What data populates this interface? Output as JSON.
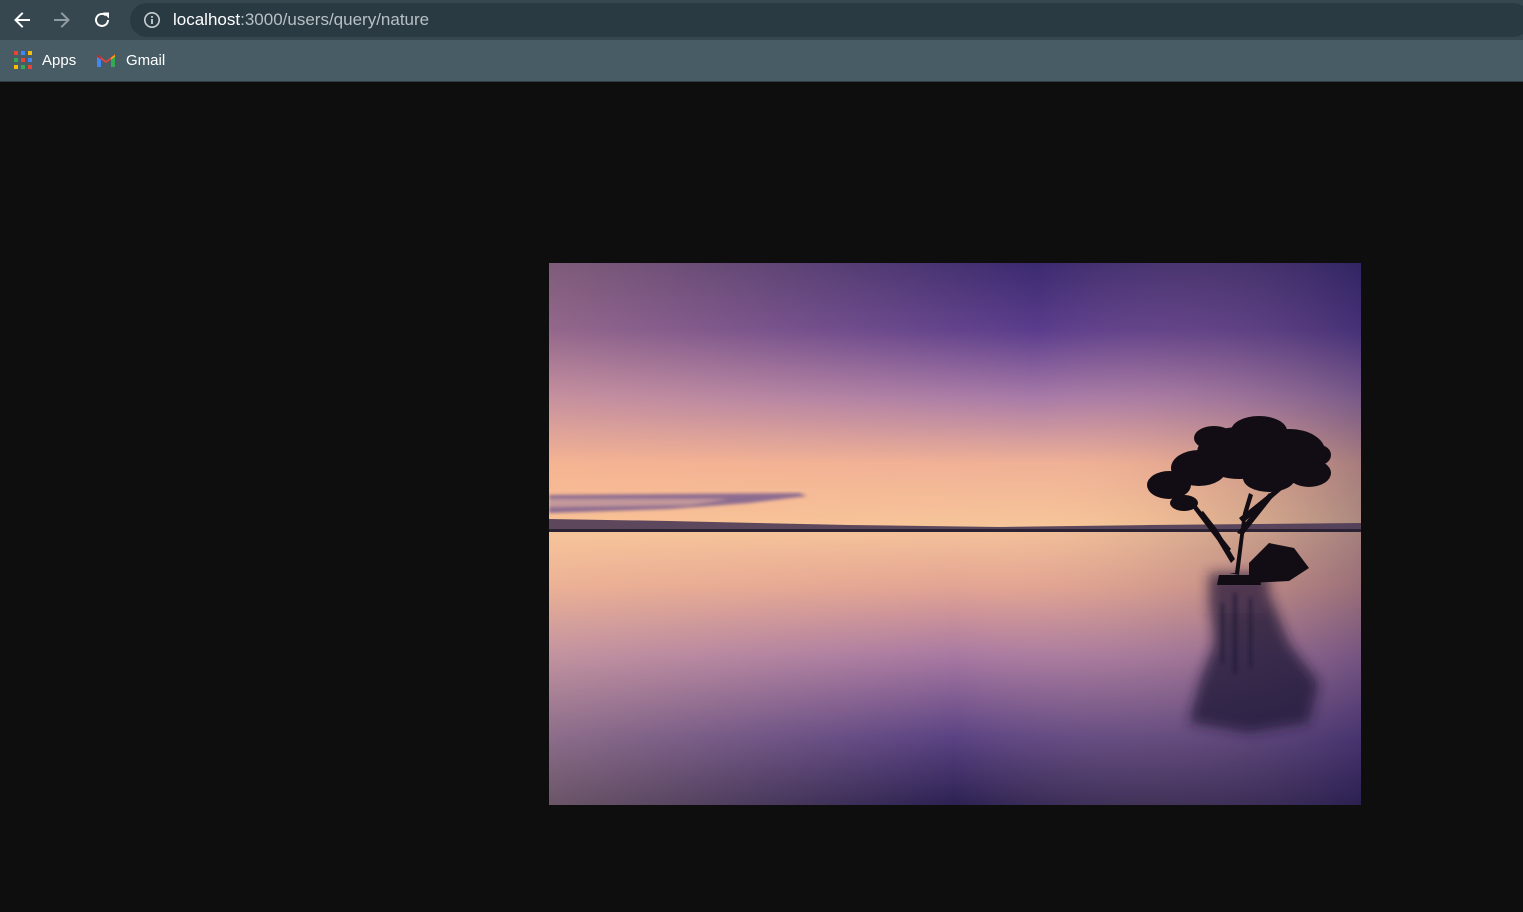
{
  "browser": {
    "address_bar": {
      "host": "localhost",
      "path": ":3000/users/query/nature"
    },
    "bookmarks": [
      {
        "label": "Apps",
        "icon": "apps-grid-icon"
      },
      {
        "label": "Gmail",
        "icon": "gmail-icon"
      }
    ],
    "colors": {
      "toolbar": "#36474f",
      "bookmarks_bar": "#475c65",
      "page_background": "#0e0e0e"
    }
  },
  "page": {
    "image": {
      "description_icon": "sunset-lake-tree-photo"
    }
  }
}
